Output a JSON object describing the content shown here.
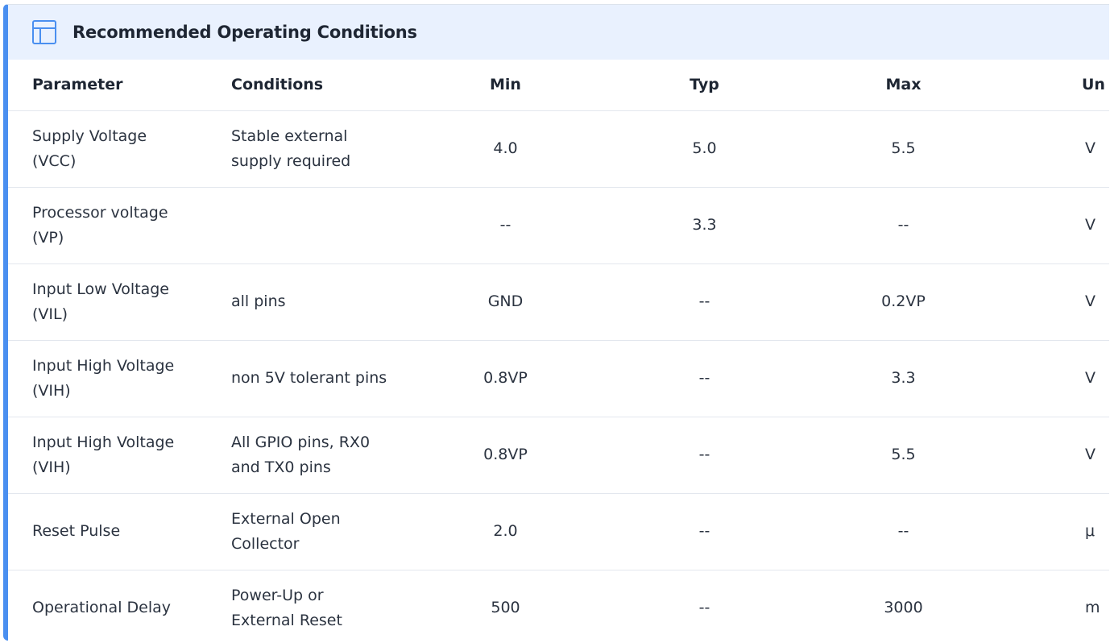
{
  "title": "Recommended Operating Conditions",
  "icon": "table-icon",
  "accent_color": "#4a8ff0",
  "header_bg": "#e9f1fe",
  "columns": [
    "Parameter",
    "Conditions",
    "Min",
    "Typ",
    "Max",
    "Un"
  ],
  "rows": [
    {
      "parameter": "Supply Voltage (VCC)",
      "conditions": "Stable external supply required",
      "min": "4.0",
      "typ": "5.0",
      "max": "5.5",
      "unit": "V"
    },
    {
      "parameter": "Processor voltage (VP)",
      "conditions": "",
      "min": "--",
      "typ": "3.3",
      "max": "--",
      "unit": "V"
    },
    {
      "parameter": "Input Low Voltage (VIL)",
      "conditions": "all pins",
      "min": "GND",
      "typ": "--",
      "max": "0.2VP",
      "unit": "V"
    },
    {
      "parameter": "Input High Voltage (VIH)",
      "conditions": "non 5V tolerant pins",
      "min": "0.8VP",
      "typ": "--",
      "max": "3.3",
      "unit": "V"
    },
    {
      "parameter": "Input High Voltage (VIH)",
      "conditions": "All GPIO pins, RX0 and TX0 pins",
      "min": "0.8VP",
      "typ": "--",
      "max": "5.5",
      "unit": "V"
    },
    {
      "parameter": "Reset Pulse",
      "conditions": "External Open Collector",
      "min": "2.0",
      "typ": "--",
      "max": "--",
      "unit": "μ"
    },
    {
      "parameter": "Operational Delay",
      "conditions": "Power-Up or External Reset",
      "min": "500",
      "typ": "--",
      "max": "3000",
      "unit": "m"
    }
  ]
}
